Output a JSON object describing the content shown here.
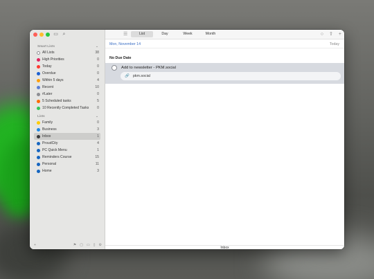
{
  "sidebar": {
    "smart_lists_header": "Smart Lists",
    "smart_lists": [
      {
        "label": "All Lists",
        "count": "38",
        "color": "#8e8e93"
      },
      {
        "label": "High Priorities",
        "count": "0",
        "color": "#e0245e"
      },
      {
        "label": "Today",
        "count": "0",
        "color": "#ff3b30"
      },
      {
        "label": "Overdue",
        "count": "0",
        "color": "#1b5fd1"
      },
      {
        "label": "Within 5 days",
        "count": "4",
        "color": "#ff9f0a"
      },
      {
        "label": "Recent",
        "count": "10",
        "color": "#5b7fd6"
      },
      {
        "label": "#Later",
        "count": "0",
        "color": "#8e8e93"
      },
      {
        "label": "5 Scheduled tasks",
        "count": "5",
        "color": "#ff6b00"
      },
      {
        "label": "10 Recently Completed Tasks",
        "count": "0",
        "color": "#34c759"
      }
    ],
    "lists_header": "Lists",
    "lists": [
      {
        "label": "Family",
        "count": "0",
        "color": "#ffcc00"
      },
      {
        "label": "Business",
        "count": "3",
        "color": "#1e88e5"
      },
      {
        "label": "Inbox",
        "count": "1",
        "color": "#3a3a3c"
      },
      {
        "label": "ProudCity",
        "count": "4",
        "color": "#1565c0"
      },
      {
        "label": "PC Quick Menu",
        "count": "1",
        "color": "#1565c0"
      },
      {
        "label": "Reminders Course",
        "count": "15",
        "color": "#1565c0"
      },
      {
        "label": "Personal",
        "count": "11",
        "color": "#1565c0"
      },
      {
        "label": "Home",
        "count": "3",
        "color": "#1565c0"
      }
    ],
    "footer_add": "+"
  },
  "toolbar": {
    "tabs": [
      "List",
      "Day",
      "Week",
      "Month"
    ],
    "active_tab": "List"
  },
  "main": {
    "date_label": "Mon, November 14",
    "today_label": "Today",
    "section_title": "No Due Date",
    "task_title": "Add to newsletter - PKM.social",
    "task_url": "pkm.social",
    "status_bar": "Inbox"
  }
}
